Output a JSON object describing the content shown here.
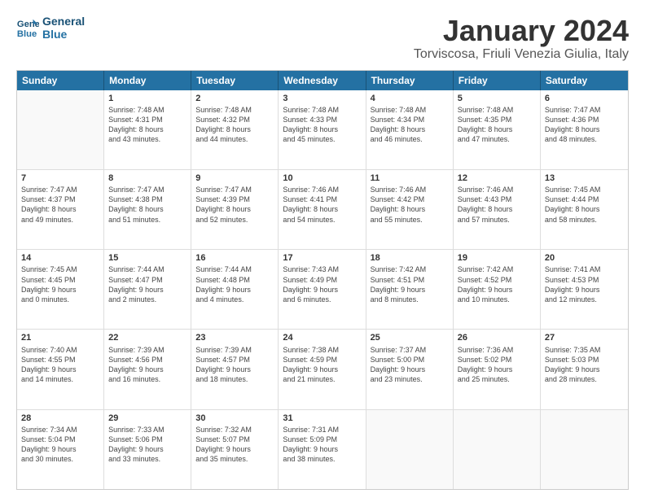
{
  "logo": {
    "line1": "General",
    "line2": "Blue"
  },
  "header": {
    "title": "January 2024",
    "subtitle": "Torviscosa, Friuli Venezia Giulia, Italy"
  },
  "weekdays": [
    "Sunday",
    "Monday",
    "Tuesday",
    "Wednesday",
    "Thursday",
    "Friday",
    "Saturday"
  ],
  "rows": [
    [
      {
        "day": "",
        "lines": []
      },
      {
        "day": "1",
        "lines": [
          "Sunrise: 7:48 AM",
          "Sunset: 4:31 PM",
          "Daylight: 8 hours",
          "and 43 minutes."
        ]
      },
      {
        "day": "2",
        "lines": [
          "Sunrise: 7:48 AM",
          "Sunset: 4:32 PM",
          "Daylight: 8 hours",
          "and 44 minutes."
        ]
      },
      {
        "day": "3",
        "lines": [
          "Sunrise: 7:48 AM",
          "Sunset: 4:33 PM",
          "Daylight: 8 hours",
          "and 45 minutes."
        ]
      },
      {
        "day": "4",
        "lines": [
          "Sunrise: 7:48 AM",
          "Sunset: 4:34 PM",
          "Daylight: 8 hours",
          "and 46 minutes."
        ]
      },
      {
        "day": "5",
        "lines": [
          "Sunrise: 7:48 AM",
          "Sunset: 4:35 PM",
          "Daylight: 8 hours",
          "and 47 minutes."
        ]
      },
      {
        "day": "6",
        "lines": [
          "Sunrise: 7:47 AM",
          "Sunset: 4:36 PM",
          "Daylight: 8 hours",
          "and 48 minutes."
        ]
      }
    ],
    [
      {
        "day": "7",
        "lines": [
          "Sunrise: 7:47 AM",
          "Sunset: 4:37 PM",
          "Daylight: 8 hours",
          "and 49 minutes."
        ]
      },
      {
        "day": "8",
        "lines": [
          "Sunrise: 7:47 AM",
          "Sunset: 4:38 PM",
          "Daylight: 8 hours",
          "and 51 minutes."
        ]
      },
      {
        "day": "9",
        "lines": [
          "Sunrise: 7:47 AM",
          "Sunset: 4:39 PM",
          "Daylight: 8 hours",
          "and 52 minutes."
        ]
      },
      {
        "day": "10",
        "lines": [
          "Sunrise: 7:46 AM",
          "Sunset: 4:41 PM",
          "Daylight: 8 hours",
          "and 54 minutes."
        ]
      },
      {
        "day": "11",
        "lines": [
          "Sunrise: 7:46 AM",
          "Sunset: 4:42 PM",
          "Daylight: 8 hours",
          "and 55 minutes."
        ]
      },
      {
        "day": "12",
        "lines": [
          "Sunrise: 7:46 AM",
          "Sunset: 4:43 PM",
          "Daylight: 8 hours",
          "and 57 minutes."
        ]
      },
      {
        "day": "13",
        "lines": [
          "Sunrise: 7:45 AM",
          "Sunset: 4:44 PM",
          "Daylight: 8 hours",
          "and 58 minutes."
        ]
      }
    ],
    [
      {
        "day": "14",
        "lines": [
          "Sunrise: 7:45 AM",
          "Sunset: 4:45 PM",
          "Daylight: 9 hours",
          "and 0 minutes."
        ]
      },
      {
        "day": "15",
        "lines": [
          "Sunrise: 7:44 AM",
          "Sunset: 4:47 PM",
          "Daylight: 9 hours",
          "and 2 minutes."
        ]
      },
      {
        "day": "16",
        "lines": [
          "Sunrise: 7:44 AM",
          "Sunset: 4:48 PM",
          "Daylight: 9 hours",
          "and 4 minutes."
        ]
      },
      {
        "day": "17",
        "lines": [
          "Sunrise: 7:43 AM",
          "Sunset: 4:49 PM",
          "Daylight: 9 hours",
          "and 6 minutes."
        ]
      },
      {
        "day": "18",
        "lines": [
          "Sunrise: 7:42 AM",
          "Sunset: 4:51 PM",
          "Daylight: 9 hours",
          "and 8 minutes."
        ]
      },
      {
        "day": "19",
        "lines": [
          "Sunrise: 7:42 AM",
          "Sunset: 4:52 PM",
          "Daylight: 9 hours",
          "and 10 minutes."
        ]
      },
      {
        "day": "20",
        "lines": [
          "Sunrise: 7:41 AM",
          "Sunset: 4:53 PM",
          "Daylight: 9 hours",
          "and 12 minutes."
        ]
      }
    ],
    [
      {
        "day": "21",
        "lines": [
          "Sunrise: 7:40 AM",
          "Sunset: 4:55 PM",
          "Daylight: 9 hours",
          "and 14 minutes."
        ]
      },
      {
        "day": "22",
        "lines": [
          "Sunrise: 7:39 AM",
          "Sunset: 4:56 PM",
          "Daylight: 9 hours",
          "and 16 minutes."
        ]
      },
      {
        "day": "23",
        "lines": [
          "Sunrise: 7:39 AM",
          "Sunset: 4:57 PM",
          "Daylight: 9 hours",
          "and 18 minutes."
        ]
      },
      {
        "day": "24",
        "lines": [
          "Sunrise: 7:38 AM",
          "Sunset: 4:59 PM",
          "Daylight: 9 hours",
          "and 21 minutes."
        ]
      },
      {
        "day": "25",
        "lines": [
          "Sunrise: 7:37 AM",
          "Sunset: 5:00 PM",
          "Daylight: 9 hours",
          "and 23 minutes."
        ]
      },
      {
        "day": "26",
        "lines": [
          "Sunrise: 7:36 AM",
          "Sunset: 5:02 PM",
          "Daylight: 9 hours",
          "and 25 minutes."
        ]
      },
      {
        "day": "27",
        "lines": [
          "Sunrise: 7:35 AM",
          "Sunset: 5:03 PM",
          "Daylight: 9 hours",
          "and 28 minutes."
        ]
      }
    ],
    [
      {
        "day": "28",
        "lines": [
          "Sunrise: 7:34 AM",
          "Sunset: 5:04 PM",
          "Daylight: 9 hours",
          "and 30 minutes."
        ]
      },
      {
        "day": "29",
        "lines": [
          "Sunrise: 7:33 AM",
          "Sunset: 5:06 PM",
          "Daylight: 9 hours",
          "and 33 minutes."
        ]
      },
      {
        "day": "30",
        "lines": [
          "Sunrise: 7:32 AM",
          "Sunset: 5:07 PM",
          "Daylight: 9 hours",
          "and 35 minutes."
        ]
      },
      {
        "day": "31",
        "lines": [
          "Sunrise: 7:31 AM",
          "Sunset: 5:09 PM",
          "Daylight: 9 hours",
          "and 38 minutes."
        ]
      },
      {
        "day": "",
        "lines": []
      },
      {
        "day": "",
        "lines": []
      },
      {
        "day": "",
        "lines": []
      }
    ]
  ]
}
